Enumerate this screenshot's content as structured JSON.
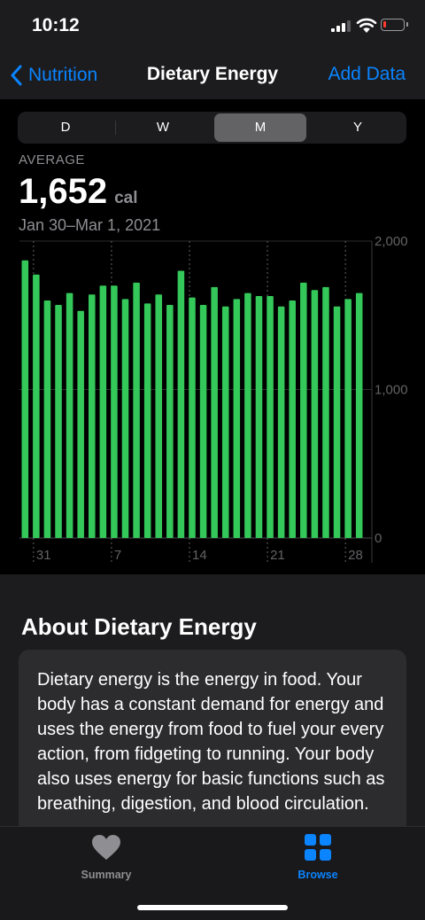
{
  "status": {
    "time": "10:12"
  },
  "nav": {
    "back_label": "Nutrition",
    "title": "Dietary Energy",
    "add_data_label": "Add Data"
  },
  "segments": [
    {
      "label": "D",
      "active": false
    },
    {
      "label": "W",
      "active": false
    },
    {
      "label": "M",
      "active": true
    },
    {
      "label": "Y",
      "active": false
    }
  ],
  "summary": {
    "average_label": "AVERAGE",
    "value": "1,652",
    "unit": "cal",
    "date_range": "Jan 30–Mar 1, 2021"
  },
  "colors": {
    "accent": "#0a84ff",
    "bar": "#34c759",
    "card": "#2c2c2e"
  },
  "chart_data": {
    "type": "bar",
    "title": "",
    "unit": "cal",
    "x_tick_labels": [
      "31",
      "7",
      "14",
      "21",
      "28"
    ],
    "y_tick_labels": [
      "2,000",
      "1,000",
      "0"
    ],
    "ylim": [
      0,
      2000
    ],
    "categories": [
      "Jan 30",
      "Jan 31",
      "Feb 1",
      "Feb 2",
      "Feb 3",
      "Feb 4",
      "Feb 5",
      "Feb 6",
      "Feb 7",
      "Feb 8",
      "Feb 9",
      "Feb 10",
      "Feb 11",
      "Feb 12",
      "Feb 13",
      "Feb 14",
      "Feb 15",
      "Feb 16",
      "Feb 17",
      "Feb 18",
      "Feb 19",
      "Feb 20",
      "Feb 21",
      "Feb 22",
      "Feb 23",
      "Feb 24",
      "Feb 25",
      "Feb 26",
      "Feb 27",
      "Feb 28",
      "Mar 1"
    ],
    "values": [
      1870,
      1775,
      1600,
      1570,
      1650,
      1530,
      1640,
      1700,
      1700,
      1610,
      1720,
      1580,
      1640,
      1570,
      1800,
      1620,
      1570,
      1690,
      1560,
      1610,
      1650,
      1630,
      1630,
      1560,
      1600,
      1720,
      1670,
      1690,
      1560,
      1610,
      1650
    ],
    "grid": true
  },
  "about": {
    "title": "About Dietary Energy",
    "text": "Dietary energy is the energy in food. Your body has a constant demand for energy and uses the energy from food to fuel your every action, from fidgeting to running. Your body also uses energy for basic functions such as breathing, digestion, and blood circulation."
  },
  "tabs": [
    {
      "label": "Summary",
      "icon": "heart-icon",
      "active": false
    },
    {
      "label": "Browse",
      "icon": "grid-icon",
      "active": true
    }
  ]
}
